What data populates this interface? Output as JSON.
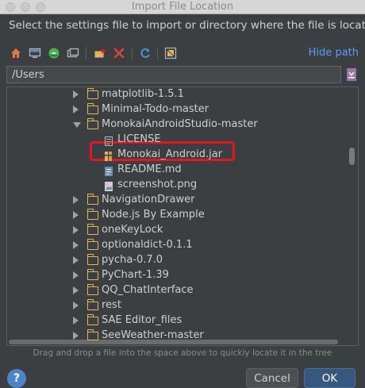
{
  "window": {
    "title": "Import File Location"
  },
  "instruction": "Select the settings file to import or directory where the file is located",
  "toolbar": {
    "icons": [
      "home-icon",
      "desktop-icon",
      "android-project-icon",
      "new-folder-icon",
      "new-module-icon",
      "delete-icon",
      "refresh-icon",
      "show-hidden-icon"
    ],
    "hide_path_label": "Hide path"
  },
  "path": {
    "value": "/Users"
  },
  "tree": {
    "rows": [
      {
        "label": "matplotlib-1.5.1",
        "kind": "folder",
        "expanded": false,
        "depth": 0
      },
      {
        "label": "Minimal-Todo-master",
        "kind": "folder",
        "expanded": false,
        "depth": 0
      },
      {
        "label": "MonokaiAndroidStudio-master",
        "kind": "folder",
        "expanded": true,
        "depth": 0
      },
      {
        "label": "LICENSE",
        "kind": "file-text",
        "depth": 1
      },
      {
        "label": "Monokai_Android.jar",
        "kind": "file-jar",
        "depth": 1,
        "highlighted": true
      },
      {
        "label": "README.md",
        "kind": "file-md",
        "depth": 1
      },
      {
        "label": "screenshot.png",
        "kind": "file-image",
        "depth": 1
      },
      {
        "label": "NavigationDrawer",
        "kind": "folder",
        "expanded": false,
        "depth": 0
      },
      {
        "label": "Node.js By Example",
        "kind": "folder",
        "expanded": false,
        "depth": 0
      },
      {
        "label": "oneKeyLock",
        "kind": "folder",
        "expanded": false,
        "depth": 0
      },
      {
        "label": "optionaldict-0.1.1",
        "kind": "folder",
        "expanded": false,
        "depth": 0
      },
      {
        "label": "pycha-0.7.0",
        "kind": "folder",
        "expanded": false,
        "depth": 0
      },
      {
        "label": "PyChart-1.39",
        "kind": "folder",
        "expanded": false,
        "depth": 0
      },
      {
        "label": "QQ_ChatInterface",
        "kind": "folder",
        "expanded": false,
        "depth": 0
      },
      {
        "label": "rest",
        "kind": "folder",
        "expanded": false,
        "depth": 0
      },
      {
        "label": "SAE Editor_files",
        "kind": "folder",
        "expanded": false,
        "depth": 0
      },
      {
        "label": "SeeWeather-master",
        "kind": "folder",
        "expanded": false,
        "depth": 0
      }
    ]
  },
  "hint": "Drag and drop a file into the space above to quickly locate it in the tree",
  "buttons": {
    "help": "?",
    "cancel": "Cancel",
    "ok": "OK"
  },
  "colors": {
    "accent": "#589df6",
    "ok_button": "#365880",
    "highlight_border": "#e8161b",
    "folder": "#e3b55a",
    "background": "#3c3f41"
  }
}
